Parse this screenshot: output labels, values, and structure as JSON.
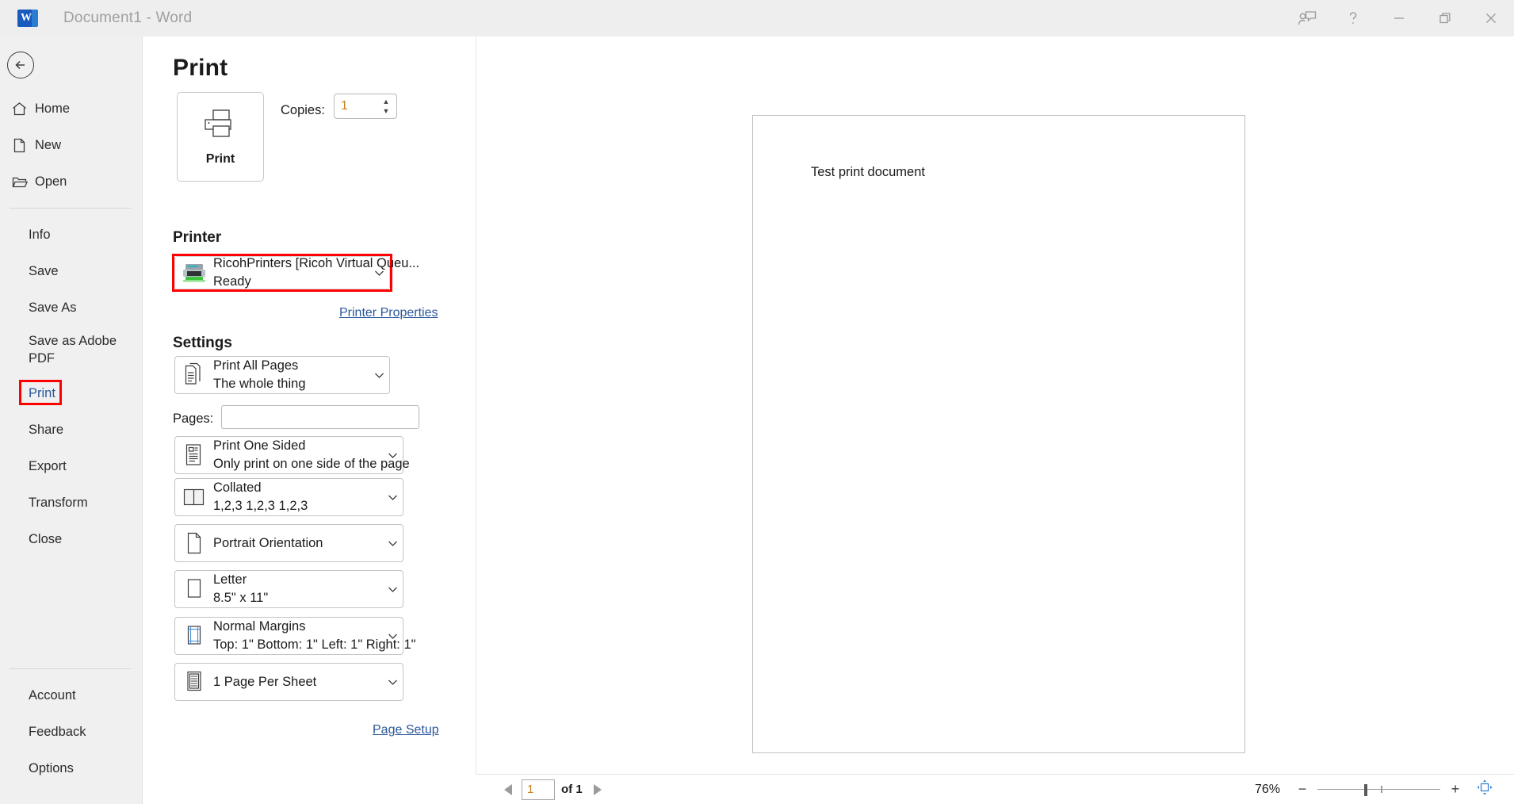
{
  "titlebar": {
    "app_icon": "word-icon",
    "document_title": "Document1  -  Word",
    "buttons": [
      {
        "name": "share-feedback-icon",
        "label": ""
      },
      {
        "name": "help-icon",
        "label": "?"
      },
      {
        "name": "minimize-icon",
        "label": ""
      },
      {
        "name": "restore-icon",
        "label": ""
      },
      {
        "name": "close-icon",
        "label": ""
      }
    ]
  },
  "sidebar": {
    "back_label": "Back",
    "top_items": [
      {
        "label": "Home",
        "icon": "home-icon"
      },
      {
        "label": "New",
        "icon": "new-document-icon"
      },
      {
        "label": "Open",
        "icon": "open-folder-icon"
      }
    ],
    "main_items": [
      {
        "label": "Info",
        "active": false,
        "highlighted": false
      },
      {
        "label": "Save",
        "active": false,
        "highlighted": false
      },
      {
        "label": "Save As",
        "active": false,
        "highlighted": false
      },
      {
        "label": "Save as Adobe PDF",
        "active": false,
        "highlighted": false
      },
      {
        "label": "Print",
        "active": true,
        "highlighted": true
      },
      {
        "label": "Share",
        "active": false,
        "highlighted": false
      },
      {
        "label": "Export",
        "active": false,
        "highlighted": false
      },
      {
        "label": "Transform",
        "active": false,
        "highlighted": false
      },
      {
        "label": "Close",
        "active": false,
        "highlighted": false
      }
    ],
    "bottom_items": [
      {
        "label": "Account"
      },
      {
        "label": "Feedback"
      },
      {
        "label": "Options"
      }
    ]
  },
  "print_pane": {
    "title": "Print",
    "print_button_label": "Print",
    "copies_label": "Copies:",
    "copies_value": "1",
    "printer_section": {
      "heading": "Printer",
      "info_icon": "info-icon",
      "selected_printer": "RicohPrinters [Ricoh Virtual Queu...",
      "status": "Ready",
      "properties_link": "Printer Properties",
      "highlight_color": "#ff0000"
    },
    "settings_section": {
      "heading": "Settings",
      "pages_label": "Pages:",
      "pages_value": "",
      "pages_placeholder": "",
      "pages_info_icon": "info-icon",
      "page_setup_link": "Page Setup",
      "items": [
        {
          "icon": "print-range-icon",
          "primary": "Print All Pages",
          "secondary": "The whole thing"
        },
        {
          "icon": "one-sided-icon",
          "primary": "Print One Sided",
          "secondary": "Only print on one side of the page"
        },
        {
          "icon": "collate-icon",
          "primary": "Collated",
          "secondary": "1,2,3    1,2,3    1,2,3"
        },
        {
          "icon": "orientation-icon",
          "primary": "Portrait Orientation",
          "secondary": ""
        },
        {
          "icon": "paper-size-icon",
          "primary": "Letter",
          "secondary": "8.5\" x 11\""
        },
        {
          "icon": "margins-icon",
          "primary": "Normal Margins",
          "secondary": "Top: 1\" Bottom: 1\" Left: 1\" Right: 1\""
        },
        {
          "icon": "pages-per-sheet-icon",
          "primary": "1 Page Per Sheet",
          "secondary": ""
        }
      ]
    }
  },
  "preview": {
    "document_text": "Test print document"
  },
  "statusbar": {
    "current_page": "1",
    "page_count_label": "of 1",
    "prev_page_icon": "previous-page-icon",
    "next_page_icon": "next-page-icon",
    "zoom_percent": "76%",
    "zoom_out_label": "−",
    "zoom_in_label": "+",
    "fit_page_icon": "zoom-to-page-icon"
  },
  "colors": {
    "accent": "#2b579a",
    "highlight": "#ff0000",
    "value_text": "#c8801e",
    "word_blue": "#185abd"
  }
}
